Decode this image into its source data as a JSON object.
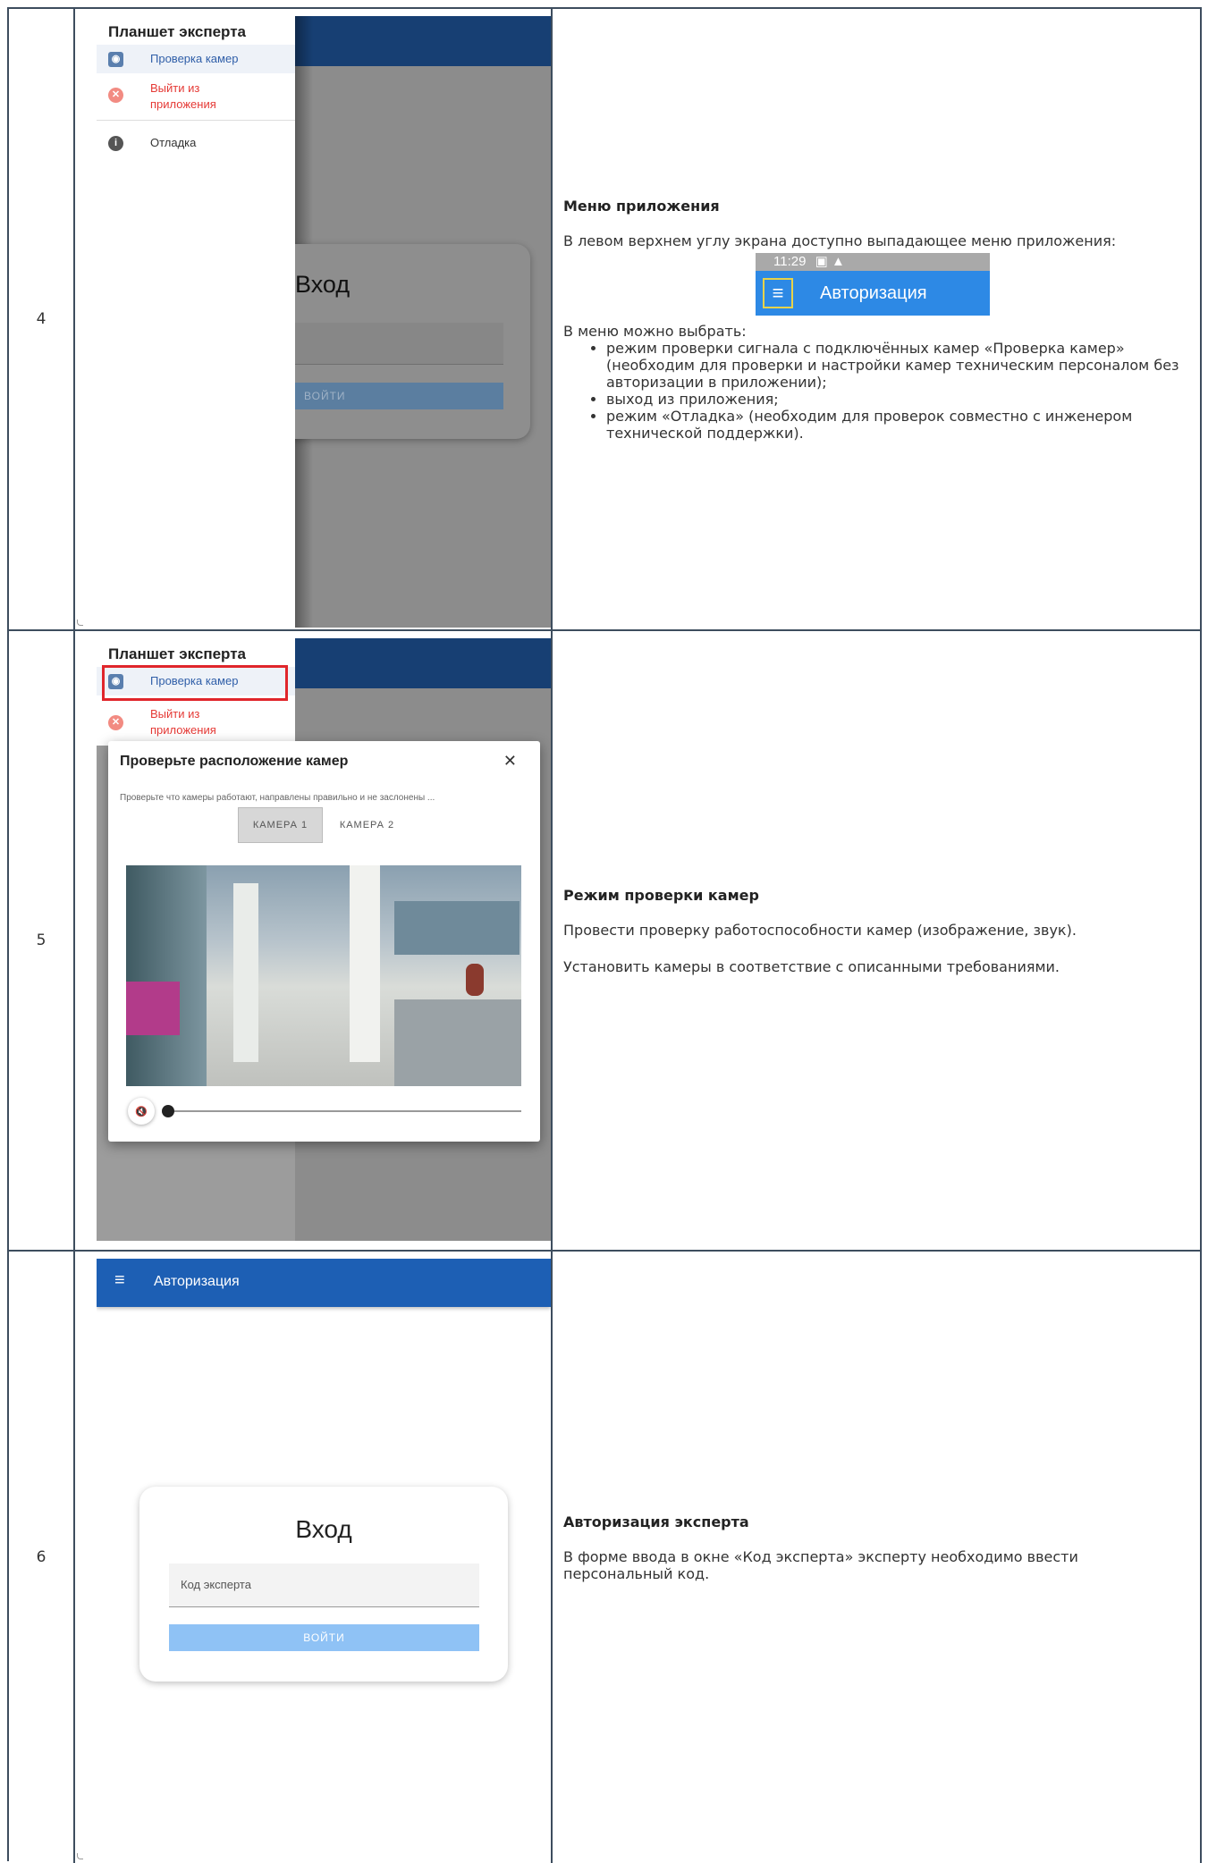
{
  "rows": [
    {
      "num": "4",
      "shot": {
        "drawer_title": "Планшет эксперта",
        "items": [
          {
            "icon": "camera-icon",
            "label": "Проверка камер",
            "color": "#2f5ea8"
          },
          {
            "icon": "exit-icon",
            "label": "Выйти из приложения",
            "color": "#e53935"
          },
          {
            "icon": "info-icon",
            "label": "Отладка",
            "color": "#333333"
          }
        ],
        "login_title": "Вход",
        "login_button": "ВОЙТИ"
      },
      "heading": "Меню приложения",
      "intro": "В левом верхнем углу экрана доступно выпадающее меню приложения:",
      "appbar": {
        "time": "11:29",
        "status_icons": "▣ ▲",
        "title": "Авторизация"
      },
      "menu_intro": "В меню можно выбрать:",
      "bullets": [
        "режим проверки сигнала с подключённых камер «Проверка камер» (необходим для проверки и настройки камер техническим персоналом без авторизации в приложении);",
        "выход из приложения;",
        "режим «Отладка» (необходим для проверок совместно с инженером технической поддержки)."
      ]
    },
    {
      "num": "5",
      "shot": {
        "drawer_title": "Планшет эксперта",
        "item1": "Проверка камер",
        "item2": "Выйти из приложения",
        "dialog_title": "Проверьте расположение камер",
        "dialog_close": "✕",
        "dialog_sub": "Проверьте что камеры работают, направлены правильно и не заслонены ...",
        "tab1": "КАМЕРА 1",
        "tab2": "КАМЕРА 2"
      },
      "heading": "Режим проверки камер",
      "p1": "Провести проверку работоспособности камер (изображение, звук).",
      "p2": "Установить камеры в соответствие с описанными требованиями."
    },
    {
      "num": "6",
      "shot": {
        "appbar_title": "Авторизация",
        "login_title": "Вход",
        "field_placeholder": "Код эксперта",
        "login_button": "ВОЙТИ"
      },
      "heading": "Авторизация эксперта",
      "p1": "В форме ввода в окне «Код эксперта» эксперту необходимо ввести персональный код."
    }
  ],
  "colors": {
    "border": "#3d4d5e",
    "appbar_blue": "#1d5fb4",
    "highlight": "#e53935",
    "button_blue": "#8fc2f5"
  }
}
